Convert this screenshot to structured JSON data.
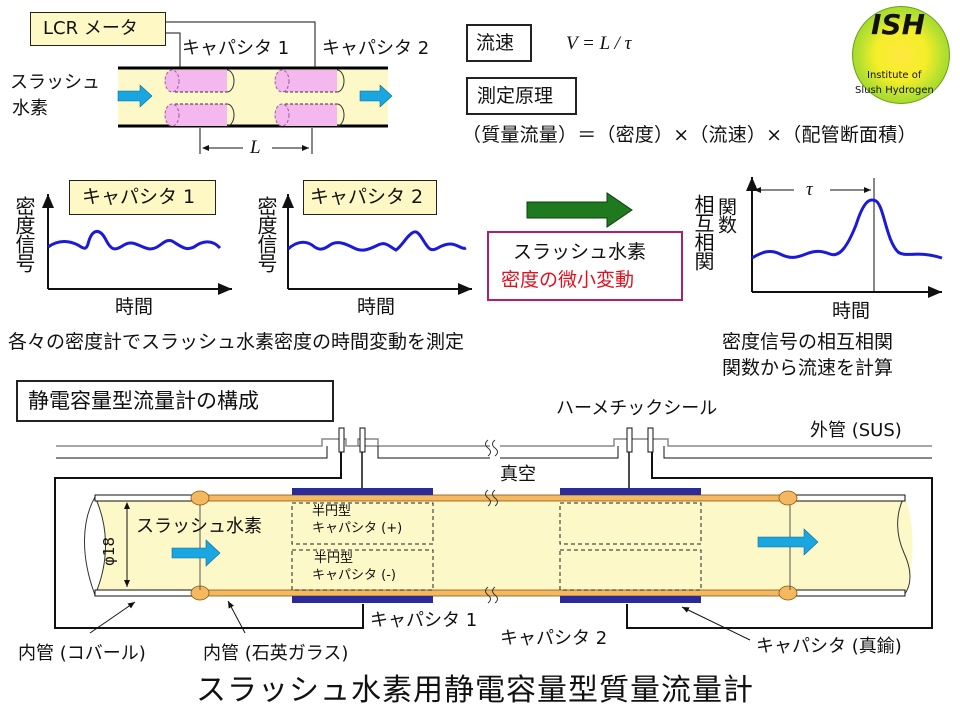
{
  "top_diagram": {
    "lcr_meter_label": "LCR メータ",
    "capacitor1_label": "キャパシタ 1",
    "capacitor2_label": "キャパシタ 2",
    "slush_label_line1": "スラッシュ",
    "slush_label_line2": "水素",
    "distance_label": "L"
  },
  "principle": {
    "velocity_heading": "流速",
    "velocity_formula": "V = L / τ",
    "measurement_heading": "測定原理",
    "mass_flow_equation": "（質量流量）＝（密度）×（流速）×（配管断面積）"
  },
  "logo": {
    "title": "ISH",
    "line1": "Institute of",
    "line2": "Slush Hydrogen"
  },
  "signal_plots": {
    "plot1_title": "キャパシタ 1",
    "plot2_title": "キャパシタ 2",
    "y_label": "密度信号",
    "x_label": "時間",
    "caption": "各々の密度計でスラッシュ水素密度の時間変動を測定"
  },
  "middle_box": {
    "line1": "スラッシュ水素",
    "line2": "密度の微小変動",
    "line2_color": "#e0101e",
    "border_color": "#b0206a"
  },
  "correlation_plot": {
    "y_label_col1": "相互相関",
    "y_label_col2": "関数",
    "x_label": "時間",
    "tau_label": "τ",
    "caption_line1": "密度信号の相互相関",
    "caption_line2": "関数から流速を計算"
  },
  "construction": {
    "heading": "静電容量型流量計の構成",
    "hermetic_seal_label": "ハーメチックシール",
    "outer_pipe_label": "外管 (SUS)",
    "vacuum_label": "真空",
    "semi_cap_plus_line1": "半円型",
    "semi_cap_plus_line2": "キャパシタ (+)",
    "semi_cap_minus_line1": "半円型",
    "semi_cap_minus_line2": "キャパシタ (-)",
    "slush_label": "スラッシュ水素",
    "diameter_label": "φ18",
    "capacitor1_label": "キャパシタ 1",
    "capacitor2_label": "キャパシタ 2",
    "inner_pipe_kovar_label": "内管 (コバール)",
    "inner_pipe_quartz_label": "内管 (石英ガラス)",
    "capacitor_brass_label": "キャパシタ (真鍮)"
  },
  "page_title": "スラッシュ水素用静電容量型質量流量計",
  "colors": {
    "pipe_fill": "#fdf8c8",
    "capacitor_pink": "#f4b8ef",
    "flow_arrow": "#1aa6e0",
    "signal_line": "#1a1ad8",
    "green_arrow": "#1f7a1f",
    "electrode": "#2a2a9a",
    "quartz": "#f4b860"
  }
}
